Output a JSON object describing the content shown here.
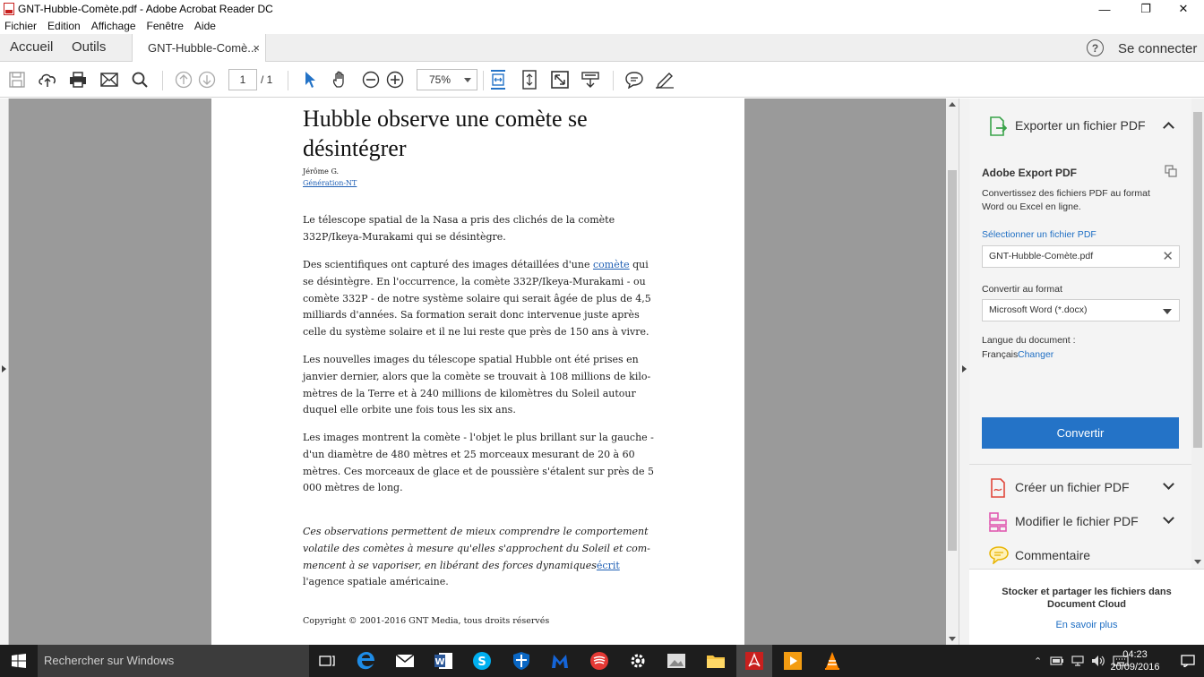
{
  "window": {
    "title": "GNT-Hubble-Comète.pdf - Adobe Acrobat Reader DC",
    "minimize": "—",
    "maximize": "❐",
    "close": "✕"
  },
  "menu": [
    "Fichier",
    "Edition",
    "Affichage",
    "Fenêtre",
    "Aide"
  ],
  "tabs": {
    "home": "Accueil",
    "tools": "Outils",
    "document": "GNT-Hubble-Comè...",
    "document_close": "×",
    "help": "?",
    "sign_in": "Se connecter"
  },
  "toolbar": {
    "page_current": "1",
    "page_total": "/ 1",
    "zoom": "75%",
    "icons": [
      "save-icon",
      "upload-icon",
      "print-icon",
      "email-icon",
      "search-icon",
      "page-up-icon",
      "page-down-icon",
      "select-cursor-icon",
      "hand-icon",
      "zoom-out-icon",
      "zoom-in-icon",
      "fit-width-icon",
      "fit-page-icon",
      "full-screen-icon",
      "scroll-mode-icon",
      "comment-icon",
      "sign-icon"
    ]
  },
  "document": {
    "title": "Hubble observe une comète se désintégrer",
    "author": "Jérôme G.",
    "source": "Génération-NT",
    "p1": "Le télescope spatial de la Nasa a pris des clichés de la comète 332P/Ikeya-Murakami qui se désintègre.",
    "p2_before": "Des scientifiques ont capturé des images détaillées d'une ",
    "p2_link": "comète",
    "p2_after": " qui se désintègre. En l'occurrence, la comète 332P/Ikeya-Murakami - ou comète 332P - de notre système solaire qui serait âgée de plus de 4,5 milliards d'années. Sa formation serait donc intervenue juste après celle du système solaire et il ne lui reste que près de 150 ans à vivre.",
    "p3": "Les nouvelles images du télescope spatial Hubble ont été prises en janvier dernier, alors que la comète se trouvait à 108 millions de kilo-mètres de la Terre et à 240 millions de kilomètres du Soleil autour duquel elle orbite une fois tous les six ans.",
    "p4": "Les images montrent la comète - l'objet le plus brillant sur la gauche - d'un diamètre de 480 mètres et 25 morceaux mesurant de 20 à 60 mètres. Ces morceaux de glace et de poussière s'étalent sur près de 5 000 mètres de long.",
    "quote_italic": "Ces observations permettent de mieux comprendre le comportement volatile des comètes à mesure qu'elles s'approchent du Soleil et com-mencent à se vaporiser, en libérant des forces dynamiques",
    "quote_link": "écrit",
    "quote_end": "l'agence spatiale américaine.",
    "copyright": "Copyright © 2001-2016 GNT Media, tous droits réservés"
  },
  "right_pane": {
    "export_title": "Exporter un fichier PDF",
    "service_name": "Adobe Export PDF",
    "description": "Convertissez des fichiers PDF au format Word ou Excel en ligne.",
    "select_file_link": "Sélectionner un fichier PDF",
    "selected_file": "GNT-Hubble-Comète.pdf",
    "convert_to_label": "Convertir au format",
    "format": "Microsoft Word (*.docx)",
    "language_label": "Langue du document :",
    "language": "Français",
    "change_link": "Changer",
    "convert_button": "Convertir",
    "tools": [
      "Créer un fichier PDF",
      "Modifier le fichier PDF",
      "Commentaire"
    ],
    "cloud_title": "Stocker et partager les fichiers dans Document Cloud",
    "cloud_link": "En savoir plus"
  },
  "taskbar": {
    "search_placeholder": "Rechercher sur Windows",
    "time": "04:23",
    "date": "20/09/2016",
    "apps": [
      "task-view-icon",
      "edge-icon",
      "mail-icon",
      "word-icon",
      "skype-icon",
      "shield-icon",
      "malwarebytes-icon",
      "winamp-icon",
      "settings-icon",
      "photos-icon",
      "file-explorer-icon",
      "acrobat-icon",
      "media-player-icon",
      "vlc-icon"
    ]
  },
  "colors": {
    "accent_blue": "#2473c7",
    "acrobat_red": "#c8201e",
    "canvas_gray": "#9a9a9a"
  }
}
